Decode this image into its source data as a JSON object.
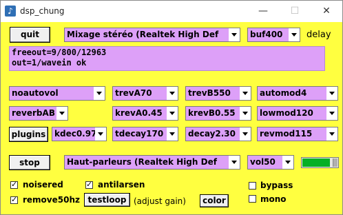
{
  "window": {
    "title": "dsp_chung",
    "minimize_glyph": "—",
    "maximize_glyph": "☐",
    "close_glyph": "✕",
    "icon": "music-note-icon"
  },
  "colors": {
    "background": "#ffff40",
    "field_purple": "#dda0f8",
    "progress_green": "#06b025"
  },
  "top": {
    "quit_label": "quit",
    "input_device": "Mixage stéréo (Realtek High Def",
    "buffer": "buf400",
    "delay_label": "delay"
  },
  "log": {
    "line1": "freeout=9/800/12963",
    "line2": "out=1/wavein ok"
  },
  "params": {
    "noautovol": "noautovol",
    "trevA": "trevA70",
    "trevB": "trevB550",
    "automod": "automod4",
    "reverbAB": "reverbAB",
    "krevA": "krevA0.45",
    "krevB": "krevB0.55",
    "lowmod": "lowmod120",
    "plugins_label": "plugins",
    "kdec": "kdec0.97",
    "tdecay": "tdecay170",
    "decay": "decay2.30",
    "revmod": "revmod115"
  },
  "output": {
    "stop_label": "stop",
    "output_device": "Haut-parleurs (Realtek High Def",
    "volume": "vol50",
    "volume_level": 0.9
  },
  "options": {
    "noisered_label": "noisered",
    "noisered_checked": true,
    "antilarsen_label": "antilarsen",
    "antilarsen_checked": true,
    "bypass_label": "bypass",
    "bypass_checked": false,
    "remove50hz_label": "remove50hz",
    "remove50hz_checked": true,
    "testloop_label": "testloop",
    "adjust_gain_label": "(adjust gain)",
    "color_label": "color",
    "mono_label": "mono",
    "mono_checked": false
  }
}
